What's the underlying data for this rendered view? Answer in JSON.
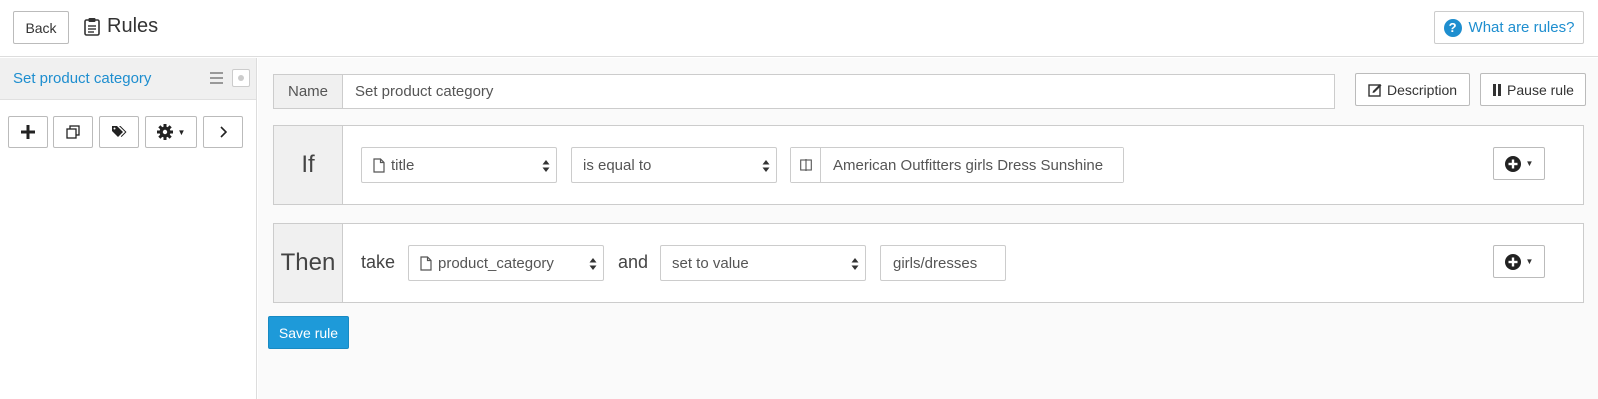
{
  "header": {
    "back_label": "Back",
    "title": "Rules",
    "help_label": "What are rules?"
  },
  "sidebar": {
    "rule_name": "Set product category",
    "tools": [
      {
        "icon": "plus-icon"
      },
      {
        "icon": "duplicate-icon"
      },
      {
        "icon": "tags-icon"
      },
      {
        "icon": "gear-icon"
      },
      {
        "icon": "chevron-right-icon"
      }
    ]
  },
  "rule": {
    "name_label": "Name",
    "name_value": "Set product category",
    "description_label": "Description",
    "pause_label": "Pause rule",
    "if": {
      "label": "If",
      "field": "title",
      "operator": "is equal to",
      "value": "American Outfitters girls Dress Sunshine"
    },
    "then": {
      "label": "Then",
      "take_word": "take",
      "field": "product_category",
      "and_word": "and",
      "action": "set to value",
      "value": "girls/dresses"
    },
    "save_label": "Save rule"
  },
  "colors": {
    "accent": "#1e8ecf",
    "save_button": "#1e9ad9",
    "panel_bg": "#f0f0f0"
  }
}
